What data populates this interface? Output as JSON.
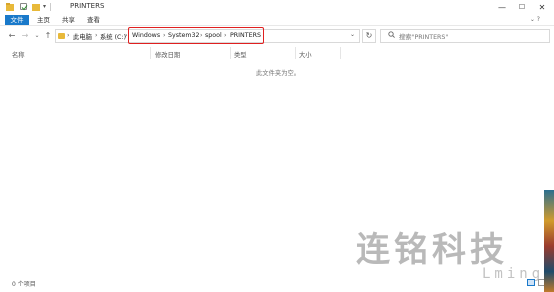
{
  "window": {
    "title": "PRINTERS",
    "controls": {
      "minimize": "—",
      "maximize": "☐",
      "close": "✕"
    }
  },
  "ribbon": {
    "tabs": [
      "文件",
      "主页",
      "共享",
      "查看"
    ],
    "right": "⌄ ?"
  },
  "nav": {
    "back": "←",
    "forward": "→",
    "history": "⌄",
    "up": "↑",
    "breadcrumbs": [
      "此电脑",
      "系统 (C:)",
      "Windows",
      "System32",
      "spool",
      "PRINTERS"
    ],
    "separator": "›",
    "dropdown": "⌄",
    "refresh": "↻",
    "search_placeholder": "搜索\"PRINTERS\""
  },
  "columns": [
    "名称",
    "修改日期",
    "类型",
    "大小"
  ],
  "empty_message": "此文件夹为空。",
  "status": {
    "item_count": "0 个项目"
  },
  "watermark": {
    "cn": "连铭科技",
    "en": "Lming"
  },
  "colors": {
    "accent": "#1979ca",
    "highlight": "#e02020",
    "folder": "#e8b93a"
  }
}
